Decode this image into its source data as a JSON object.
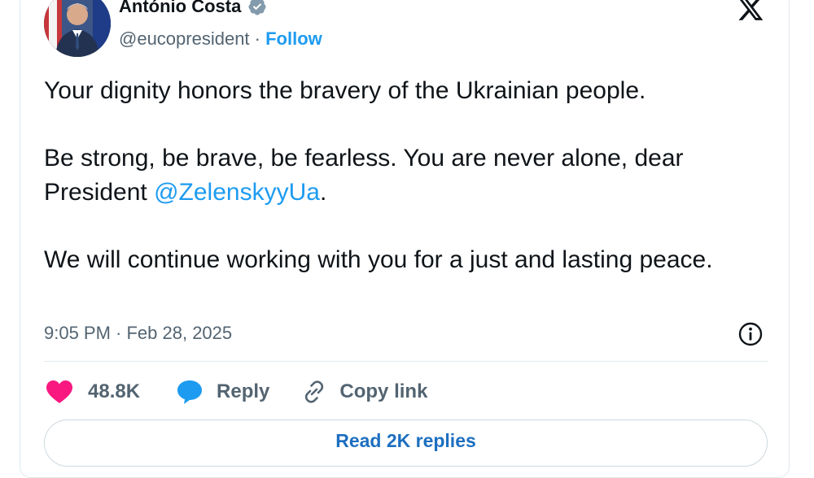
{
  "author": {
    "name": "António Costa",
    "handle": "@eucopresident",
    "separator": " · ",
    "follow_label": "Follow",
    "verified_color": "#829aab"
  },
  "tweet": {
    "paragraphs": [
      "Your dignity honors the bravery of the Ukrainian people.",
      "Be strong, be brave, be fearless. You are never alone, dear President ",
      "We will continue working with you for a just and lasting peace."
    ],
    "mention": "@ZelenskyyUa",
    "mention_suffix": ".",
    "timestamp": "9:05 PM · Feb 28, 2025"
  },
  "actions": {
    "like_count": "48.8K",
    "reply_label": "Reply",
    "copy_label": "Copy link"
  },
  "read_replies_label": "Read 2K replies",
  "icons": {
    "brand": "x-logo-icon",
    "verified": "verified-badge-icon",
    "info": "info-icon",
    "like": "heart-icon",
    "reply": "speech-bubble-icon",
    "copy": "link-icon"
  },
  "colors": {
    "accent": "#1d9bf0",
    "like": "#f91880",
    "reply_icon": "#1d9bf0",
    "text": "#0f1419",
    "muted": "#536471"
  }
}
